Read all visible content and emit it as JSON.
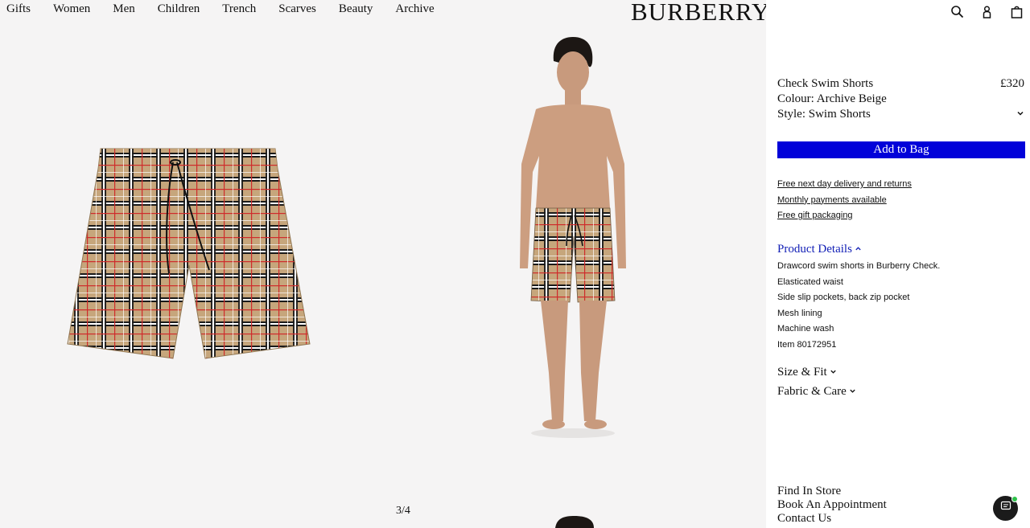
{
  "nav": [
    "Gifts",
    "Women",
    "Men",
    "Children",
    "Trench",
    "Scarves",
    "Beauty",
    "Archive"
  ],
  "brand": "BURBERRY",
  "icons": {
    "search": "search-icon",
    "account": "account-icon",
    "bag": "bag-icon",
    "chat": "chat-icon"
  },
  "gallery": {
    "counter": "3/4"
  },
  "product": {
    "name": "Check Swim Shorts",
    "price": "£320",
    "colour": "Colour: Archive Beige",
    "style": "Style: Swim Shorts",
    "add_to_bag": "Add to Bag"
  },
  "services": [
    "Free next day delivery and returns",
    "Monthly payments available",
    "Free gift packaging"
  ],
  "details": {
    "title": "Product Details",
    "items": [
      "Drawcord swim shorts in Burberry Check.",
      "Elasticated waist",
      "Side slip pockets, back zip pocket",
      "Mesh lining",
      "Machine wash",
      "Item 80172951"
    ]
  },
  "size_fit": "Size & Fit",
  "fabric_care": "Fabric & Care",
  "footer": [
    "Find In Store",
    "Book An Appointment",
    "Contact Us"
  ],
  "colors": {
    "accent": "#0202d9",
    "link_blue": "#1320b6",
    "check_beige": "#c6a67c",
    "check_red": "#cf2b2b",
    "gallery_bg": "#f5f4f4"
  }
}
